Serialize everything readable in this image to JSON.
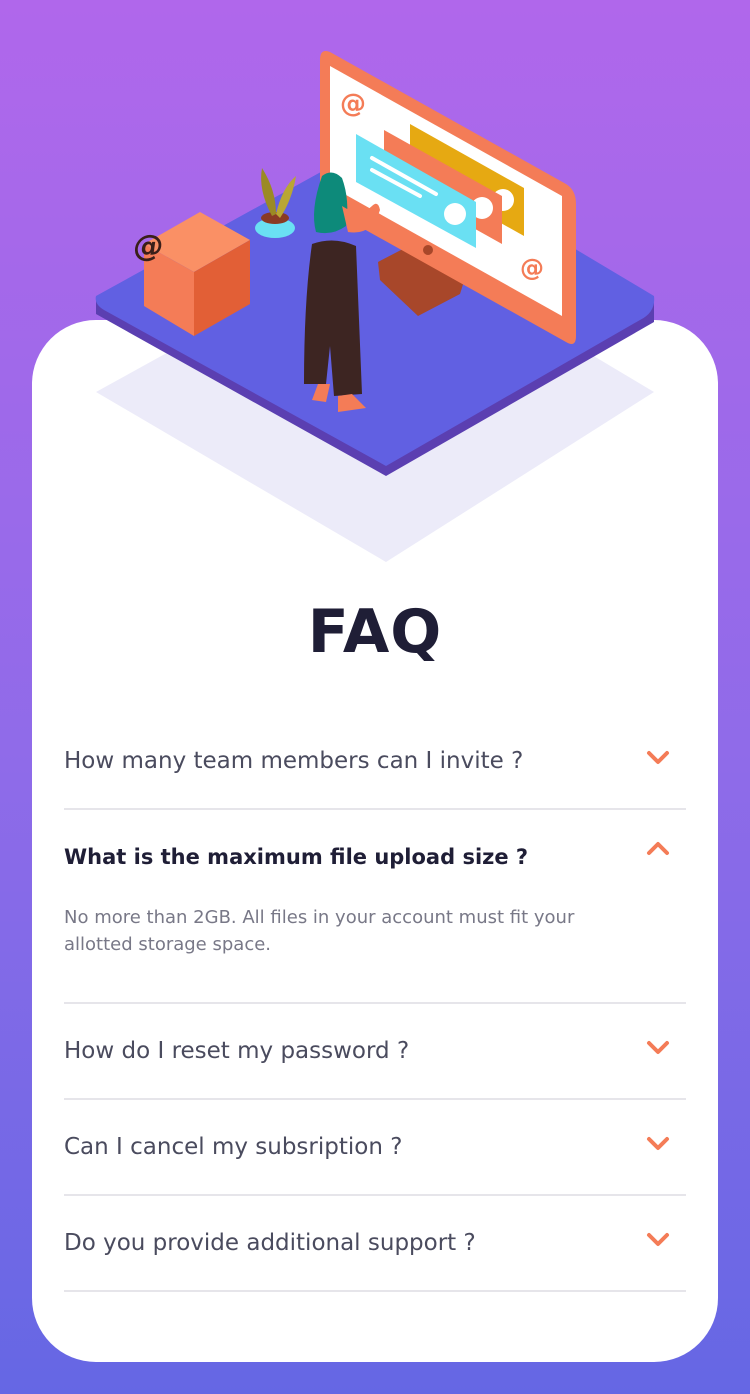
{
  "colors": {
    "accent": "#f47c57",
    "title": "#1f1e36",
    "question": "#4a4b5e",
    "answer": "#787887",
    "divider": "#e6e5ea",
    "bg_top": "#b067eb",
    "bg_bottom": "#6567e4"
  },
  "faq": {
    "title": "FAQ",
    "items": [
      {
        "question": "How many team members can I invite ?",
        "answer": "",
        "open": false,
        "icon": "chevron-down-icon"
      },
      {
        "question": "What is the maximum file upload size ?",
        "answer": "No more than 2GB. All files in your account must fit your allotted storage space.",
        "open": true,
        "icon": "chevron-up-icon"
      },
      {
        "question": "How do I reset my password ?",
        "answer": "",
        "open": false,
        "icon": "chevron-down-icon"
      },
      {
        "question": "Can I cancel my subsription ?",
        "answer": "",
        "open": false,
        "icon": "chevron-down-icon"
      },
      {
        "question": "Do you provide additional support ?",
        "answer": "",
        "open": false,
        "icon": "chevron-down-icon"
      }
    ]
  }
}
